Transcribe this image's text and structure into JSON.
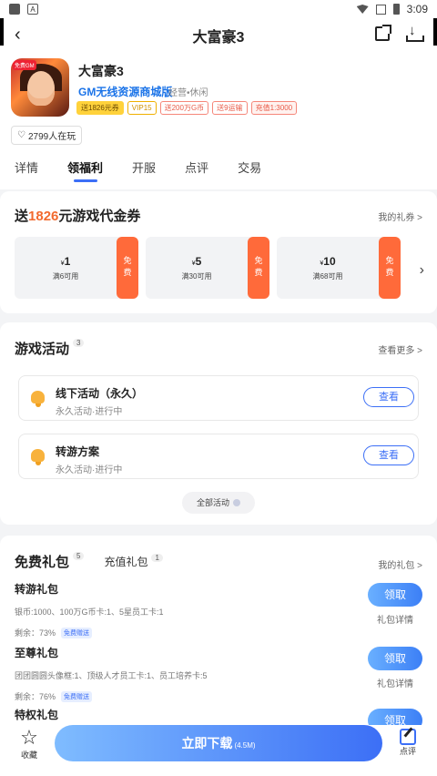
{
  "status": {
    "time": "3:09"
  },
  "nav": {
    "title": "大富豪3"
  },
  "game": {
    "name": "大富豪3",
    "subtitle": "GM无线资源商城版",
    "meta": "经营•休闲",
    "icon_tag": "免费GM",
    "badges": [
      "送1826元券",
      "VIP15",
      "送200万G币",
      "送9运输",
      "充值1:3000"
    ],
    "players": "2799人在玩"
  },
  "tabs": [
    "详情",
    "领福利",
    "开服",
    "点评",
    "交易"
  ],
  "active_tab": "领福利",
  "vouchers": {
    "title_prefix": "送",
    "title_amount": "1826",
    "title_suffix": "元游戏代金券",
    "link": "我的礼券 >",
    "items": [
      {
        "currency": "¥",
        "amount": "1",
        "condition": "满6可用",
        "free": "免费"
      },
      {
        "currency": "¥",
        "amount": "5",
        "condition": "满30可用",
        "free": "免费"
      },
      {
        "currency": "¥",
        "amount": "10",
        "condition": "满68可用",
        "free": "免费"
      }
    ]
  },
  "activities": {
    "title": "游戏活动",
    "count": "3",
    "link": "查看更多 >",
    "items": [
      {
        "name": "线下活动（永久）",
        "meta": "永久活动·进行中",
        "button": "查看"
      },
      {
        "name": "转游方案",
        "meta": "永久活动·进行中",
        "button": "查看"
      }
    ],
    "all_label": "全部活动"
  },
  "gifts": {
    "tab_free": "免费礼包",
    "tab_free_count": "5",
    "tab_recharge": "充值礼包",
    "tab_recharge_count": "1",
    "link": "我的礼包 >",
    "items": [
      {
        "name": "转游礼包",
        "desc": "银币:1000、100万G币卡:1、5星员工卡:1",
        "remaining": "剩余：73%",
        "tag": "免费赠送",
        "button": "领取",
        "detail": "礼包详情"
      },
      {
        "name": "至尊礼包",
        "desc": "团团圆圆头像框:1、顶级人才员工卡:1、员工培养卡:5",
        "remaining": "剩余：76%",
        "tag": "免费赠送",
        "button": "领取",
        "detail": "礼包详情"
      },
      {
        "name": "特权礼包",
        "button": "领取"
      }
    ]
  },
  "bottom": {
    "fav": "收藏",
    "download": "立即下载",
    "download_size": "(4.5M)",
    "review": "点评"
  }
}
